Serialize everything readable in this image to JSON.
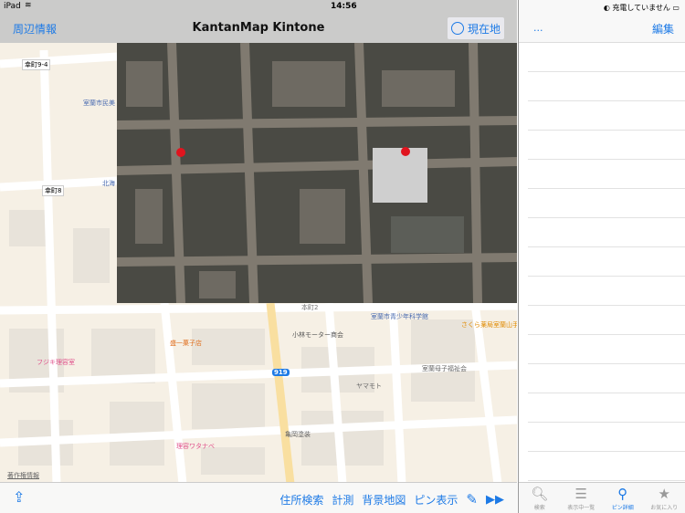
{
  "status": {
    "device": "iPad",
    "time": "14:56",
    "charging": "充電していません"
  },
  "navbar": {
    "left": "周辺情報",
    "title": "KantanMap Kintone",
    "location_button": "現在地"
  },
  "map": {
    "labels": {
      "stop1": "幸町9-4",
      "stop2": "幸町8",
      "museum": "室蘭市民美",
      "hokkai": "北海",
      "science": "室蘭市青少年科学館",
      "kobayashi": "小林モーター商会",
      "sakura": "さくら薬局室蘭山手",
      "sweets": "盛一菓子店",
      "fujiki": "フジキ理容室",
      "boshi": "室蘭母子福祉会",
      "yamamoto": "ヤマモト",
      "kameoka": "亀岡塗装",
      "watanabe": "理容ワタナベ",
      "route": "919",
      "honcho": "本町2",
      "legal": "著作権情報"
    }
  },
  "toolbar": {
    "address_search": "住所検索",
    "measure": "計測",
    "background_map": "背景地図",
    "pin_display": "ピン表示"
  },
  "right": {
    "more": "...",
    "edit": "編集",
    "row_count": 15,
    "tabs": [
      {
        "label": "検索",
        "icon": "search-icon"
      },
      {
        "label": "表示中一覧",
        "icon": "notepad-icon"
      },
      {
        "label": "ピン詳細",
        "icon": "pin-icon",
        "active": true
      },
      {
        "label": "お気に入り",
        "icon": "star-icon"
      }
    ]
  },
  "colors": {
    "accent": "#1d7ae6",
    "pin": "#e0141e"
  }
}
